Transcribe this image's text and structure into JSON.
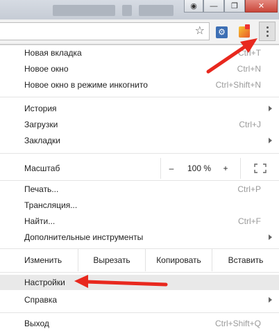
{
  "menu": {
    "new_tab": {
      "label": "Новая вкладка",
      "shortcut": "Ctrl+T"
    },
    "new_window": {
      "label": "Новое окно",
      "shortcut": "Ctrl+N"
    },
    "incognito": {
      "label": "Новое окно в режиме инкогнито",
      "shortcut": "Ctrl+Shift+N"
    },
    "history": {
      "label": "История"
    },
    "downloads": {
      "label": "Загрузки",
      "shortcut": "Ctrl+J"
    },
    "bookmarks": {
      "label": "Закладки"
    },
    "zoom": {
      "label": "Масштаб",
      "minus": "–",
      "value": "100 %",
      "plus": "+"
    },
    "print": {
      "label": "Печать...",
      "shortcut": "Ctrl+P"
    },
    "cast": {
      "label": "Трансляция..."
    },
    "find": {
      "label": "Найти...",
      "shortcut": "Ctrl+F"
    },
    "more_tools": {
      "label": "Дополнительные инструменты"
    },
    "edit": {
      "label": "Изменить",
      "cut": "Вырезать",
      "copy": "Копировать",
      "paste": "Вставить"
    },
    "settings": {
      "label": "Настройки"
    },
    "help": {
      "label": "Справка"
    },
    "exit": {
      "label": "Выход",
      "shortcut": "Ctrl+Shift+Q"
    }
  },
  "toolbar": {
    "star_icon": "☆",
    "ext1_icon": "⚙"
  },
  "colors": {
    "annotation_arrow": "#e8281e",
    "highlight": "#e9e9e9"
  }
}
